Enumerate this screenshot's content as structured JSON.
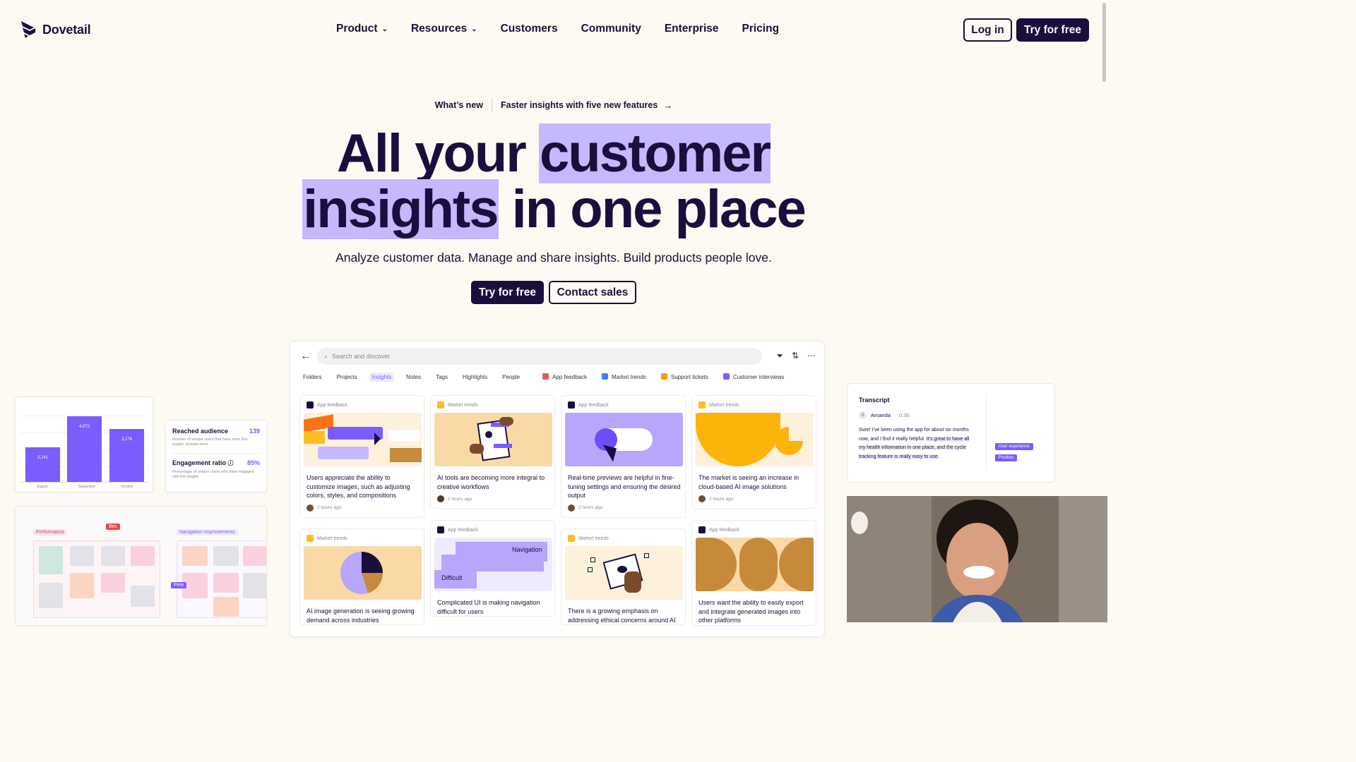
{
  "brand": {
    "name": "Dovetail"
  },
  "nav": {
    "items": [
      {
        "label": "Product",
        "has_dropdown": true
      },
      {
        "label": "Resources",
        "has_dropdown": true
      },
      {
        "label": "Customers",
        "has_dropdown": false
      },
      {
        "label": "Community",
        "has_dropdown": false
      },
      {
        "label": "Enterprise",
        "has_dropdown": false
      },
      {
        "label": "Pricing",
        "has_dropdown": false
      }
    ],
    "login": "Log in",
    "try": "Try for free"
  },
  "hero": {
    "announce_label": "What’s new",
    "announce_text": "Faster insights with five new features",
    "title_l1_a": "All your ",
    "title_l1_b": "customer",
    "title_l2_a": "insights",
    "title_l2_b": " in one place",
    "subtitle": "Analyze customer data. Manage and share insights. Build products people love.",
    "cta_primary": "Try for free",
    "cta_secondary": "Contact sales"
  },
  "app": {
    "search_placeholder": "Search and discover",
    "tabs": [
      "Folders",
      "Projects",
      "Insights",
      "Notes",
      "Tags",
      "Highlights",
      "People"
    ],
    "active_tab": "Insights",
    "sources": [
      {
        "label": "App feedback",
        "color": "#e85a4f"
      },
      {
        "label": "Market trends",
        "color": "#3b82f6"
      },
      {
        "label": "Support tickets",
        "color": "#f59e0b"
      },
      {
        "label": "Customer interviews",
        "color": "#7b5cff"
      }
    ],
    "cards": [
      {
        "source": "App feedback",
        "title": "Users appreciate the ability to customize images, such as adjusting colors, styles, and compositions",
        "meta": "2 hours ago",
        "bg": "#fdf1dc"
      },
      {
        "source": "Market trends",
        "title": "AI tools are becoming more integral to creative workflows",
        "meta": "2 hours ago",
        "bg": "#f9d9a6"
      },
      {
        "source": "App feedback",
        "title": "Real-time previews are helpful in fine-tuning settings and ensuring the desired output",
        "meta": "2 hours ago",
        "bg": "#b7a6fb"
      },
      {
        "source": "Market trends",
        "title": "The market is seeing an increase in cloud-based AI image solutions",
        "meta": "2 hours ago",
        "bg": "#fdf1dc"
      },
      {
        "source": "Market trends",
        "title": "AI image generation is seeing growing demand across industries",
        "meta": "",
        "bg": "#f9d9a6"
      },
      {
        "source": "App feedback",
        "title": "Complicated UI is making navigation difficult for users",
        "meta": "",
        "bg": "#efeaff"
      },
      {
        "source": "Market trends",
        "title": "There is a growing emphasis on addressing ethical concerns around AI",
        "meta": "",
        "bg": "#fdf1dc"
      },
      {
        "source": "App feedback",
        "title": "Users want the ability to easily export and integrate generated images into other platforms",
        "meta": "",
        "bg": "#f9d9a6"
      }
    ],
    "nav_labels": {
      "navigation": "Navigation",
      "difficult": "Difficult"
    }
  },
  "left_panels": {
    "bars": {
      "categories": [
        "August",
        "September",
        "October"
      ],
      "values": [
        2141,
        4072,
        3276
      ],
      "value_labels": [
        "2,141",
        "4,072",
        "3,276"
      ]
    },
    "metrics": [
      {
        "title": "Reached audience",
        "value": "139",
        "desc": "Number of unique users that have seen this insight, at least once."
      },
      {
        "title": "Engagement ratio",
        "value": "85%",
        "desc": "Percentage of unique users who have engaged with the insight."
      }
    ],
    "board_tags": [
      "Performance",
      "Navigation improvements"
    ],
    "cursors": [
      "Bec",
      "Pete"
    ]
  },
  "transcript": {
    "title": "Transcript",
    "initial": "S",
    "speaker": "Amanda",
    "time": "0:36",
    "text_plain": "Sure! I've been using the app for about six months now, and I find it really helpful.",
    "text_highlight": "It's great to have all my health information in one place, and the cycle tracking feature is really easy to use.",
    "chips": [
      "User experience",
      "Positive"
    ]
  }
}
